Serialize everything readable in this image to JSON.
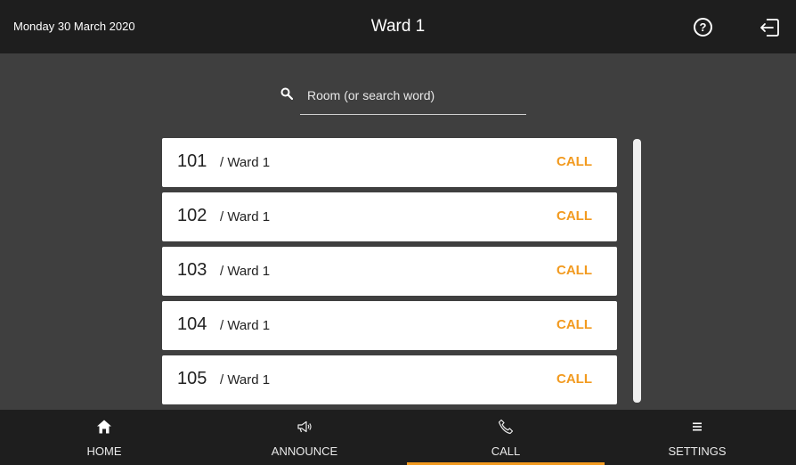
{
  "header": {
    "date": "Monday 30 March 2020",
    "title": "Ward 1",
    "help_icon": "help-circle-icon",
    "help_glyph": "?",
    "exit_icon": "logout-icon"
  },
  "search": {
    "placeholder": "Room (or search word)",
    "value": "",
    "icon": "search-icon"
  },
  "rooms": [
    {
      "number": "101",
      "ward": "/ Ward 1",
      "action": "CALL"
    },
    {
      "number": "102",
      "ward": "/ Ward 1",
      "action": "CALL"
    },
    {
      "number": "103",
      "ward": "/ Ward 1",
      "action": "CALL"
    },
    {
      "number": "104",
      "ward": "/ Ward 1",
      "action": "CALL"
    },
    {
      "number": "105",
      "ward": "/ Ward 1",
      "action": "CALL"
    }
  ],
  "nav": [
    {
      "label": "HOME",
      "icon": "home-icon",
      "active": false
    },
    {
      "label": "ANNOUNCE",
      "icon": "megaphone-icon",
      "active": false
    },
    {
      "label": "CALL",
      "icon": "phone-icon",
      "active": true
    },
    {
      "label": "SETTINGS",
      "icon": "menu-icon",
      "active": false
    }
  ],
  "colors": {
    "accent": "#f29a1f",
    "bar_background": "#1e1e1e",
    "page_background": "#3f3f3f"
  }
}
